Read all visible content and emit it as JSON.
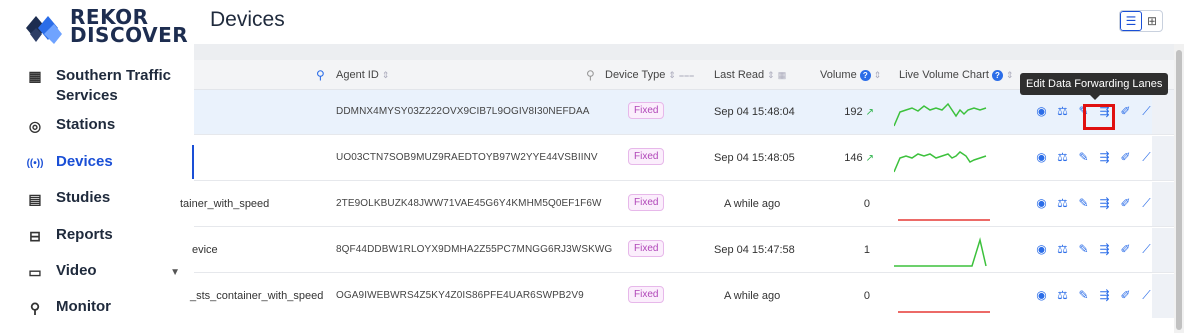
{
  "brand": {
    "line1": "REKOR",
    "line2": "DISCOVER",
    "color": "#1d2d50"
  },
  "sidebar": {
    "items": [
      {
        "label": "Southern Traffic Services",
        "icon": "building-icon"
      },
      {
        "label": "Stations",
        "icon": "location-pin-icon"
      },
      {
        "label": "Devices",
        "icon": "broadcast-icon",
        "active": true
      },
      {
        "label": "Studies",
        "icon": "clipboard-icon"
      },
      {
        "label": "Reports",
        "icon": "car-icon"
      },
      {
        "label": "Video",
        "icon": "video-camera-icon",
        "has_dropdown": true
      },
      {
        "label": "Monitor",
        "icon": "magnify-icon"
      }
    ],
    "accent": "#1a4fd6"
  },
  "header": {
    "title": "Devices"
  },
  "table": {
    "columns": {
      "agent_id": "Agent ID",
      "device_type": "Device Type",
      "last_read": "Last Read",
      "volume": "Volume",
      "live_chart": "Live Volume Chart"
    },
    "rows": [
      {
        "name": "",
        "agent_id": "DDMNX4MYSY03Z222OVX9CIB7L9OGIV8I30NEFDAA",
        "type": "Fixed",
        "last_read": "Sep 04 15:48:04",
        "volume": "192",
        "trend": true,
        "chart": "green-wave",
        "selected": true
      },
      {
        "name": "",
        "agent_id": "UO03CTN7SOB9MUZ9RAEDTOYB97W2YYE44VSBIINV",
        "type": "Fixed",
        "last_read": "Sep 04 15:48:05",
        "volume": "146",
        "trend": true,
        "chart": "green-wave2"
      },
      {
        "name": "tainer_with_speed",
        "agent_id": "2TE9OLKBUZK48JWW71VAE45G6Y4KMHM5Q0EF1F6W",
        "type": "Fixed",
        "last_read": "A while ago",
        "volume": "0",
        "trend": false,
        "chart": "red-flat"
      },
      {
        "name": "evice",
        "agent_id": "8QF44DDBW1RLOYX9DMHA2Z55PC7MNGG6RJ3WSKWG",
        "type": "Fixed",
        "last_read": "Sep 04 15:47:58",
        "volume": "1",
        "trend": false,
        "chart": "green-spike"
      },
      {
        "name": "_sts_container_with_speed",
        "agent_id": "OGA9IWEBWRS4Z5KY4Z0IS86PFE4UAR6SWPB2V9",
        "type": "Fixed",
        "last_read": "A while ago",
        "volume": "0",
        "trend": false,
        "chart": "red-flat"
      }
    ]
  },
  "tooltip": {
    "text": "Edit Data Forwarding Lanes"
  },
  "colors": {
    "badge": "#b046b8",
    "link": "#2b6de8",
    "chart_green": "#3cc13c",
    "chart_red": "#e53935",
    "highlight": "#e01010"
  }
}
